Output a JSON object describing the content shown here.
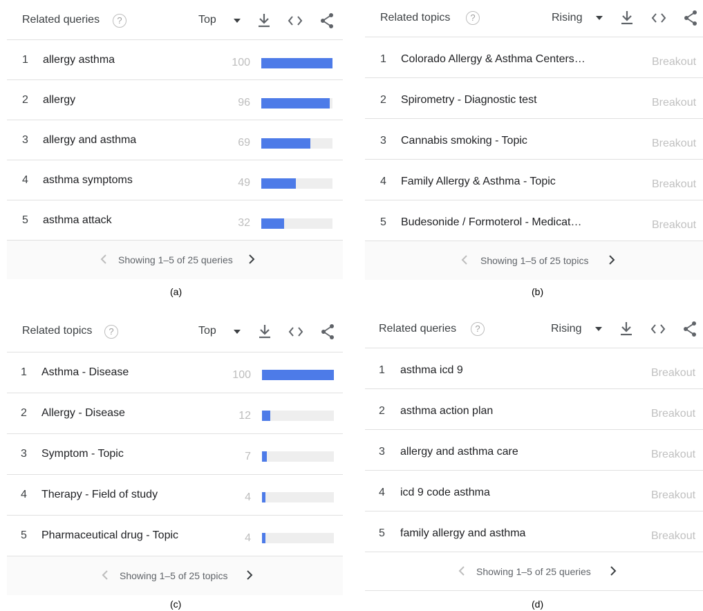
{
  "panels": {
    "a": {
      "title": "Related queries",
      "help": "?",
      "sort": "Top",
      "rows": [
        {
          "rank": "1",
          "label": "allergy asthma",
          "value": "100",
          "level": 100
        },
        {
          "rank": "2",
          "label": "allergy",
          "value": "96",
          "level": 96
        },
        {
          "rank": "3",
          "label": "allergy and asthma",
          "value": "69",
          "level": 69
        },
        {
          "rank": "4",
          "label": "asthma symptoms",
          "value": "49",
          "level": 49
        },
        {
          "rank": "5",
          "label": "asthma attack",
          "value": "32",
          "level": 32
        }
      ],
      "pager": "Showing 1–5 of 25 queries",
      "caption": "(a)"
    },
    "b": {
      "title": "Related topics",
      "help": "?",
      "sort": "Rising",
      "rows": [
        {
          "rank": "1",
          "label": "Colorado Allergy & Asthma Centers…",
          "value": "Breakout"
        },
        {
          "rank": "2",
          "label": "Spirometry - Diagnostic test",
          "value": "Breakout"
        },
        {
          "rank": "3",
          "label": "Cannabis smoking - Topic",
          "value": "Breakout"
        },
        {
          "rank": "4",
          "label": "Family Allergy & Asthma - Topic",
          "value": "Breakout"
        },
        {
          "rank": "5",
          "label": "Budesonide / Formoterol - Medicat…",
          "value": "Breakout"
        }
      ],
      "pager": "Showing 1–5 of 25 topics",
      "caption": "(b)"
    },
    "c": {
      "title": "Related topics",
      "help": "?",
      "sort": "Top",
      "rows": [
        {
          "rank": "1",
          "label": "Asthma - Disease",
          "value": "100",
          "level": 100
        },
        {
          "rank": "2",
          "label": "Allergy - Disease",
          "value": "12",
          "level": 12
        },
        {
          "rank": "3",
          "label": "Symptom - Topic",
          "value": "7",
          "level": 7
        },
        {
          "rank": "4",
          "label": "Therapy - Field of study",
          "value": "4",
          "level": 4
        },
        {
          "rank": "5",
          "label": "Pharmaceutical drug - Topic",
          "value": "4",
          "level": 4
        }
      ],
      "pager": "Showing 1–5 of 25 topics",
      "caption": "(c)"
    },
    "d": {
      "title": "Related queries",
      "help": "?",
      "sort": "Rising",
      "rows": [
        {
          "rank": "1",
          "label": "asthma icd 9",
          "value": "Breakout"
        },
        {
          "rank": "2",
          "label": "asthma action plan",
          "value": "Breakout"
        },
        {
          "rank": "3",
          "label": "allergy and asthma care",
          "value": "Breakout"
        },
        {
          "rank": "4",
          "label": "icd 9 code asthma",
          "value": "Breakout"
        },
        {
          "rank": "5",
          "label": "family allergy and asthma",
          "value": "Breakout"
        }
      ],
      "pager": "Showing 1–5 of 25 queries",
      "caption": "(d)"
    }
  },
  "icons": {
    "help": "help-circle-icon",
    "sort": "caret-down-icon",
    "download": "download-icon",
    "embed": "embed-code-icon",
    "share": "share-icon",
    "prev": "chevron-left-icon",
    "next": "chevron-right-icon"
  },
  "colors": {
    "bar_fill": "#4d7be8",
    "bar_track": "#eeeeee",
    "breakout_text": "#c0c0c0",
    "value_text": "#bdbdbd"
  }
}
